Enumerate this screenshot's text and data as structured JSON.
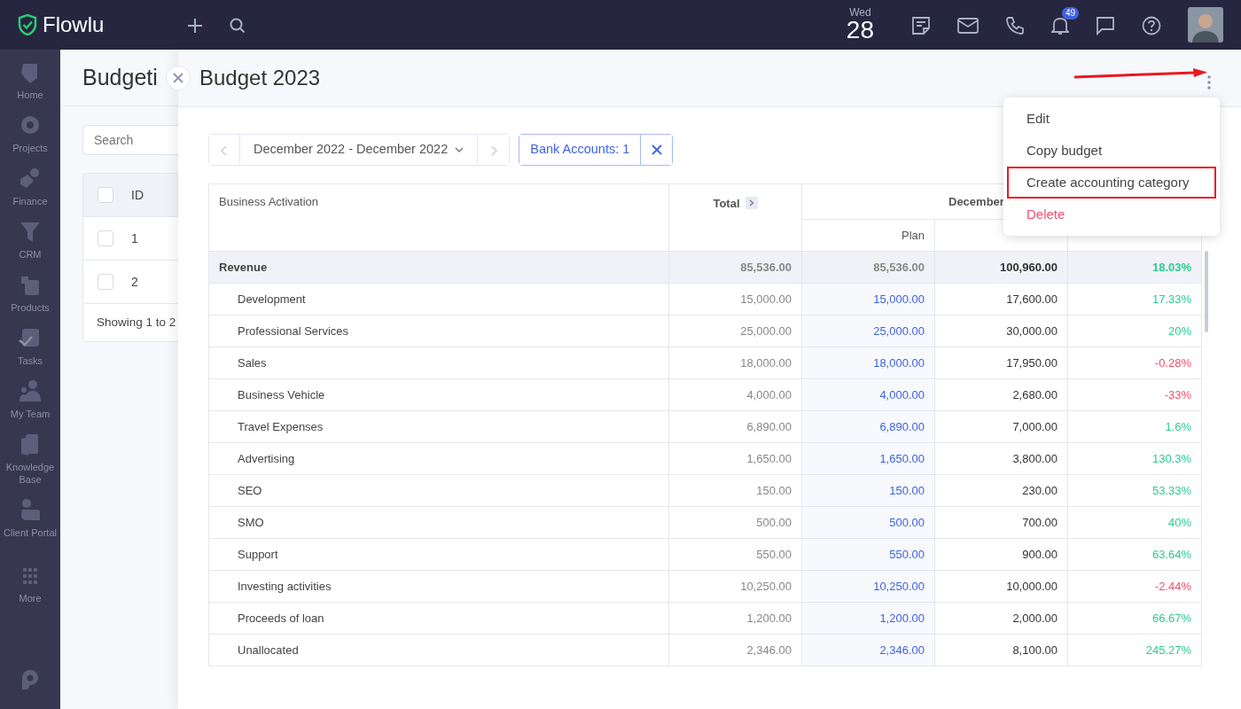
{
  "app": {
    "logo": "Flowlu",
    "day": "Wed",
    "date": "28",
    "notifications": "49"
  },
  "sidebar": {
    "items": [
      {
        "label": "Home"
      },
      {
        "label": "Projects"
      },
      {
        "label": "Finance"
      },
      {
        "label": "CRM"
      },
      {
        "label": "Products"
      },
      {
        "label": "Tasks"
      },
      {
        "label": "My Team"
      },
      {
        "label": "Knowledge Base"
      },
      {
        "label": "Client Portal"
      },
      {
        "label": "More"
      }
    ]
  },
  "background_list": {
    "title": "Budgeti",
    "search": {
      "placeholder": "Search"
    },
    "id_header": "ID",
    "all_checked": false,
    "rows": [
      {
        "id": "1",
        "checked": false
      },
      {
        "id": "2",
        "checked": false
      }
    ],
    "footer": "Showing 1 to 2"
  },
  "panel": {
    "title": "Budget 2023",
    "period": "December 2022 - December 2022",
    "filter": "Bank Accounts: 1",
    "menu": [
      {
        "label": "Edit",
        "kind": "normal",
        "highlighted": false
      },
      {
        "label": "Copy budget",
        "kind": "normal",
        "highlighted": false
      },
      {
        "label": "Create accounting category",
        "kind": "normal",
        "highlighted": true
      },
      {
        "label": "Delete",
        "kind": "danger",
        "highlighted": false
      }
    ],
    "table": {
      "columns": [
        "Business Activation",
        "Total",
        "December",
        "Plan"
      ],
      "rows": [
        {
          "kind": "group",
          "name": "Revenue",
          "total": "85,536.00",
          "plan": "85,536.00",
          "actual": "100,960.00",
          "diff": "18.03%",
          "color": "#2ecc8f"
        },
        {
          "kind": "item",
          "name": "Development",
          "total": "15,000.00",
          "plan": "15,000.00",
          "actual": "17,600.00",
          "diff": "17.33%",
          "color": "#2ecc8f"
        },
        {
          "kind": "item",
          "name": "Professional Services",
          "total": "25,000.00",
          "plan": "25,000.00",
          "actual": "30,000.00",
          "diff": "20%",
          "color": "#2ecc8f"
        },
        {
          "kind": "item",
          "name": "Sales",
          "total": "18,000.00",
          "plan": "18,000.00",
          "actual": "17,950.00",
          "diff": "-0.28%",
          "color": "#f0506e"
        },
        {
          "kind": "item",
          "name": "Business Vehicle",
          "total": "4,000.00",
          "plan": "4,000.00",
          "actual": "2,680.00",
          "diff": "-33%",
          "color": "#f0506e"
        },
        {
          "kind": "item",
          "name": "Travel Expenses",
          "total": "6,890.00",
          "plan": "6,890.00",
          "actual": "7,000.00",
          "diff": "1.6%",
          "color": "#2ecc8f"
        },
        {
          "kind": "item",
          "name": "Advertising",
          "total": "1,650.00",
          "plan": "1,650.00",
          "actual": "3,800.00",
          "diff": "130.3%",
          "color": "#2ecc8f"
        },
        {
          "kind": "item",
          "name": "SEO",
          "total": "150.00",
          "plan": "150.00",
          "actual": "230.00",
          "diff": "53.33%",
          "color": "#2ecc8f"
        },
        {
          "kind": "item",
          "name": "SMO",
          "total": "500.00",
          "plan": "500.00",
          "actual": "700.00",
          "diff": "40%",
          "color": "#2ecc8f"
        },
        {
          "kind": "item",
          "name": "Support",
          "total": "550.00",
          "plan": "550.00",
          "actual": "900.00",
          "diff": "63.64%",
          "color": "#2ecc8f"
        },
        {
          "kind": "item",
          "name": "Investing activities",
          "total": "10,250.00",
          "plan": "10,250.00",
          "actual": "10,000.00",
          "diff": "-2.44%",
          "color": "#f0506e"
        },
        {
          "kind": "item",
          "name": "Proceeds of loan",
          "total": "1,200.00",
          "plan": "1,200.00",
          "actual": "2,000.00",
          "diff": "66.67%",
          "color": "#2ecc8f"
        },
        {
          "kind": "item",
          "name": "Unallocated",
          "total": "2,346.00",
          "plan": "2,346.00",
          "actual": "8,100.00",
          "diff": "245.27%",
          "color": "#2ecc8f"
        }
      ]
    }
  },
  "annotation": {
    "arrow": true
  }
}
